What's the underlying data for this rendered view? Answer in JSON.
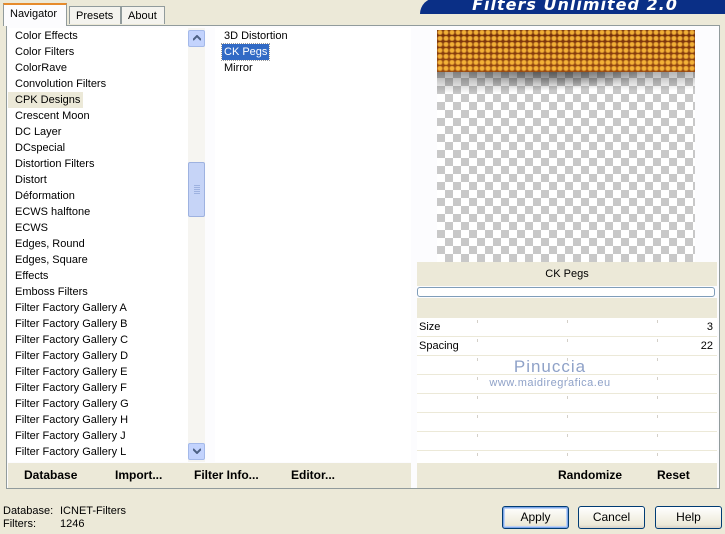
{
  "tabs": [
    "Navigator",
    "Presets",
    "About"
  ],
  "banner": "Filters Unlimited 2.0",
  "categories": [
    "Color Effects",
    "Color Filters",
    "ColorRave",
    "Convolution Filters",
    "CPK Designs",
    "Crescent Moon",
    "DC Layer",
    "DCspecial",
    "Distortion Filters",
    "Distort",
    "Déformation",
    "ECWS halftone",
    "ECWS",
    "Edges, Round",
    "Edges, Square",
    "Effects",
    "Emboss Filters",
    "Filter Factory Gallery A",
    "Filter Factory Gallery B",
    "Filter Factory Gallery C",
    "Filter Factory Gallery D",
    "Filter Factory Gallery E",
    "Filter Factory Gallery F",
    "Filter Factory Gallery G",
    "Filter Factory Gallery H",
    "Filter Factory Gallery J",
    "Filter Factory Gallery L"
  ],
  "highlighted_category": "CPK Designs",
  "filters": [
    "3D Distortion",
    "CK Pegs",
    "Mirror"
  ],
  "selected_filter": "CK Pegs",
  "preview": {
    "filter_name": "CK Pegs"
  },
  "params": [
    {
      "name": "Size",
      "value": "3"
    },
    {
      "name": "Spacing",
      "value": "22"
    }
  ],
  "watermark": {
    "line1": "Pinuccia",
    "line2": "www.maidiregrafica.eu"
  },
  "bottom_buttons": {
    "database": "Database",
    "import": "Import...",
    "filter_info": "Filter Info...",
    "editor": "Editor...",
    "randomize": "Randomize",
    "reset": "Reset"
  },
  "status": {
    "database_label": "Database:",
    "database_value": "ICNET-Filters",
    "filters_label": "Filters:",
    "filters_value": "1246"
  },
  "dialog_buttons": {
    "apply": "Apply",
    "cancel": "Cancel",
    "help": "Help"
  },
  "colors": {
    "selection": "#316ac5",
    "banner": "#0a2f86",
    "tab_accent": "#e68b2c"
  }
}
